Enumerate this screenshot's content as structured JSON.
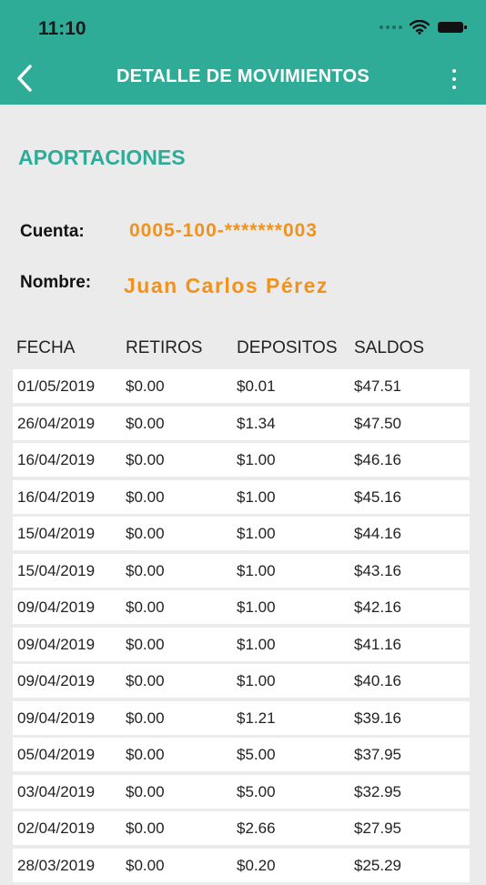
{
  "status": {
    "time": "11:10"
  },
  "header": {
    "title": "DETALLE DE MOVIMIENTOS"
  },
  "section": {
    "title": "APORTACIONES"
  },
  "account": {
    "cuenta_label": "Cuenta:",
    "cuenta_value": "0005-100-*******003",
    "nombre_label": "Nombre:",
    "nombre_value": "Juan Carlos Pérez"
  },
  "table": {
    "columns": [
      "FECHA",
      "RETIROS",
      "DEPOSITOS",
      "SALDOS"
    ],
    "rows": [
      [
        "01/05/2019",
        "$0.00",
        "$0.01",
        "$47.51"
      ],
      [
        "26/04/2019",
        "$0.00",
        "$1.34",
        "$47.50"
      ],
      [
        "16/04/2019",
        "$0.00",
        "$1.00",
        "$46.16"
      ],
      [
        "16/04/2019",
        "$0.00",
        "$1.00",
        "$45.16"
      ],
      [
        "15/04/2019",
        "$0.00",
        "$1.00",
        "$44.16"
      ],
      [
        "15/04/2019",
        "$0.00",
        "$1.00",
        "$43.16"
      ],
      [
        "09/04/2019",
        "$0.00",
        "$1.00",
        "$42.16"
      ],
      [
        "09/04/2019",
        "$0.00",
        "$1.00",
        "$41.16"
      ],
      [
        "09/04/2019",
        "$0.00",
        "$1.00",
        "$40.16"
      ],
      [
        "09/04/2019",
        "$0.00",
        "$1.21",
        "$39.16"
      ],
      [
        "05/04/2019",
        "$0.00",
        "$5.00",
        "$37.95"
      ],
      [
        "03/04/2019",
        "$0.00",
        "$5.00",
        "$32.95"
      ],
      [
        "02/04/2019",
        "$0.00",
        "$2.66",
        "$27.95"
      ],
      [
        "28/03/2019",
        "$0.00",
        "$0.20",
        "$25.29"
      ]
    ]
  },
  "colors": {
    "header_bg": "#2fac98",
    "accent_teal": "#2fac98",
    "accent_orange": "#f0921e",
    "page_bg": "#ebebeb"
  },
  "icons": {
    "back": "chevron-left-icon",
    "menu": "more-vertical-icon",
    "wifi": "wifi-icon",
    "battery": "battery-icon",
    "signal": "signal-icon"
  }
}
